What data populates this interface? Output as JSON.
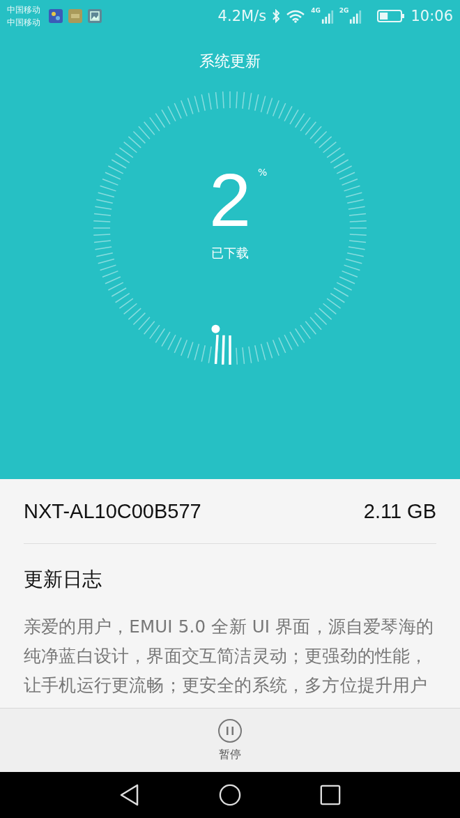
{
  "status_bar": {
    "carriers": [
      "中国移动",
      "中国移动"
    ],
    "speed": "4.2M/s",
    "network_labels": [
      "4G",
      "2G"
    ],
    "time": "10:06"
  },
  "header": {
    "title": "系统更新"
  },
  "progress": {
    "value": "2",
    "unit": "%",
    "caption": "已下载"
  },
  "package": {
    "name": "NXT-AL10C00B577",
    "size": "2.11 GB"
  },
  "changelog": {
    "heading": "更新日志",
    "lines": [
      "亲爱的用户，EMUI 5.0 全新 UI 界面，源自爱琴海的",
      "纯净蓝白设计，界面交互简洁灵动；更强劲的性能，",
      "让手机运行更流畅；更安全的系统，多方位提升用户"
    ]
  },
  "action": {
    "label": "暂停",
    "kind": "pause"
  }
}
